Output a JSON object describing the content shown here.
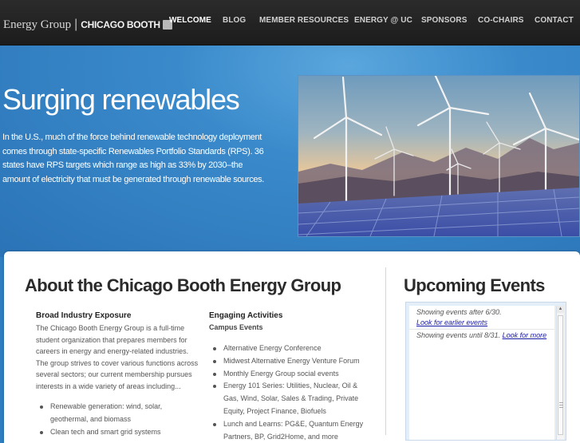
{
  "brand": {
    "group_name": "Energy Group",
    "separator": "|",
    "logo_text": "CHICAGO BOOTH"
  },
  "nav": {
    "items": [
      {
        "label": "WELCOME",
        "active": true
      },
      {
        "label": "BLOG"
      },
      {
        "label": "MEMBER RESOURCES"
      },
      {
        "label": "ENERGY @ UC"
      },
      {
        "label": "SPONSORS"
      },
      {
        "label": "CO-CHAIRS"
      },
      {
        "label": "CONTACT"
      }
    ]
  },
  "hero": {
    "title": "Surging renewables",
    "text": "In the U.S., much of the force behind renewable technology deployment comes through state-specific Renewables Portfolio Standards (RPS). 36 states have RPS targets which range as high as 33% by 2030–the amount of electricity that must be generated through renewable sources.",
    "image": "wind-turbines-and-solar-panels-photo"
  },
  "about": {
    "title": "About the Chicago Booth Energy Group",
    "left": {
      "heading": "Broad Industry Exposure",
      "text": "The Chicago Booth Energy Group is a full-time student organization that prepares members for careers in energy and energy-related industries. The group strives to cover various functions across several sectors; our current membership pursues interests in a wide variety of areas including...",
      "bullets": [
        "Renewable generation: wind, solar, geothermal, and biomass",
        "Clean tech and smart grid systems"
      ]
    },
    "right": {
      "heading": "Engaging Activities",
      "subheading": "Campus Events",
      "bullets": [
        "Alternative Energy Conference",
        "Midwest Alternative Energy Venture Forum",
        "Monthly Energy Group social events",
        "Energy 101 Series: Utilities, Nuclear, Oil & Gas, Wind, Solar, Sales & Trading, Private Equity, Project Finance, Biofuels",
        "Lunch and Learns: PG&E, Quantum Energy Partners, BP, Grid2Home, and more"
      ]
    }
  },
  "events": {
    "title": "Upcoming Events",
    "after_text": "Showing events after 6/30.",
    "earlier_link": "Look for earlier events",
    "until_text": "Showing events until 8/31.",
    "more_link": "Look for more"
  },
  "colors": {
    "nav_bg": "#222222",
    "hero_blue": "#2f7ec0",
    "link": "#1a1aa8"
  }
}
